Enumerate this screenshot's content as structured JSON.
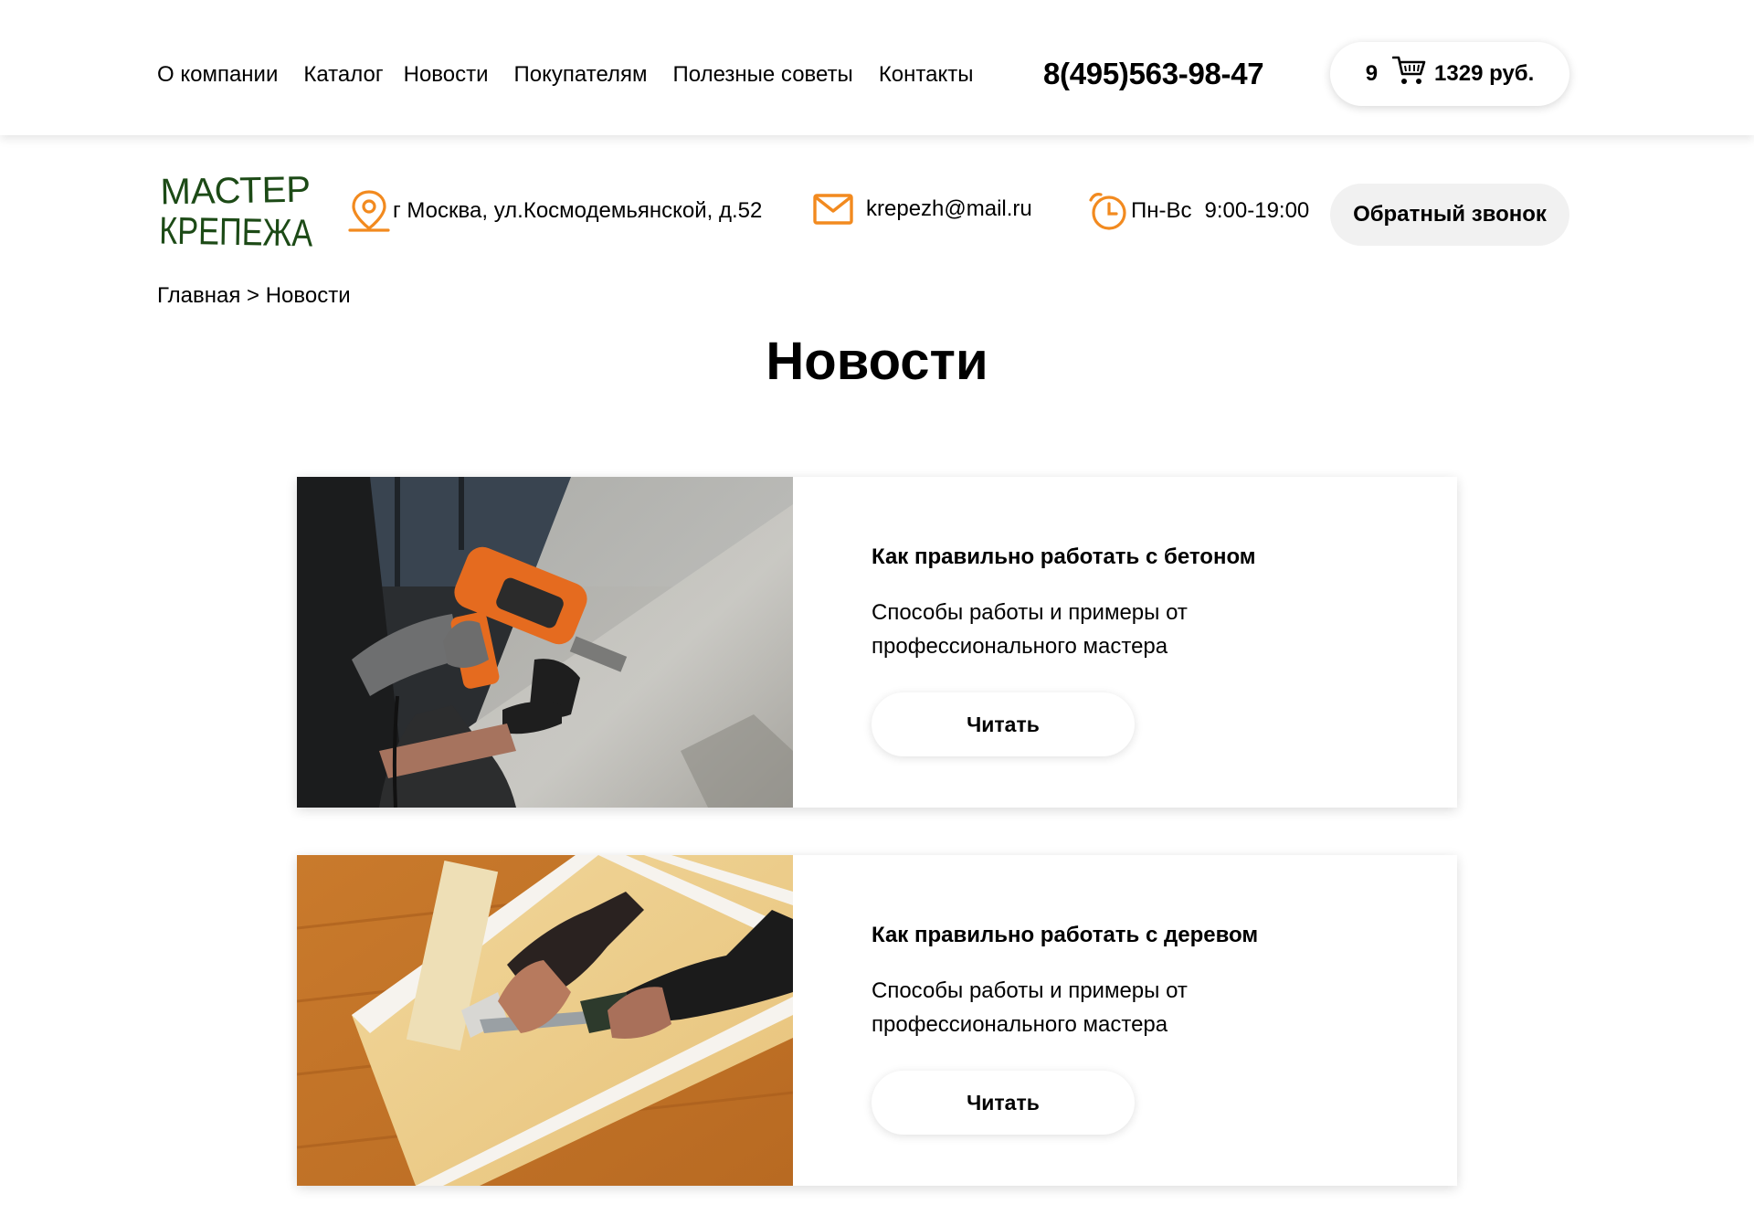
{
  "nav": {
    "items": [
      "О компании",
      "Каталог",
      "Новости",
      "Покупателям",
      "Полезные советы",
      "Контакты"
    ]
  },
  "phone": "8(495)563-98-47",
  "cart": {
    "count": "9",
    "total": "1329 руб."
  },
  "logo": {
    "line1": "МАСТЕР",
    "line2": "КРЕПЕЖА"
  },
  "contacts": {
    "address": "г Москва, ул.Космодемьянской, д.52",
    "email": "krepezh@mail.ru",
    "hours_days": "Пн-Вс",
    "hours_time": "9:00-19:00"
  },
  "callback_label": "Обратный звонок",
  "breadcrumb": {
    "home": "Главная",
    "separator": ">",
    "current": "Новости"
  },
  "page_title": "Новости",
  "articles": [
    {
      "title": "Как правильно работать с бетоном",
      "desc": "Способы работы и примеры от профессионального мастера",
      "button": "Читать",
      "image": "drilling-concrete-photo"
    },
    {
      "title": "Как правильно работать с деревом",
      "desc": "Способы работы и примеры от профессионального мастера",
      "button": "Читать",
      "image": "wood-screwdriver-photo"
    }
  ],
  "colors": {
    "accent": "#f28a1f",
    "logo": "#1c4a16",
    "callback_bg": "#f1f1f1"
  }
}
